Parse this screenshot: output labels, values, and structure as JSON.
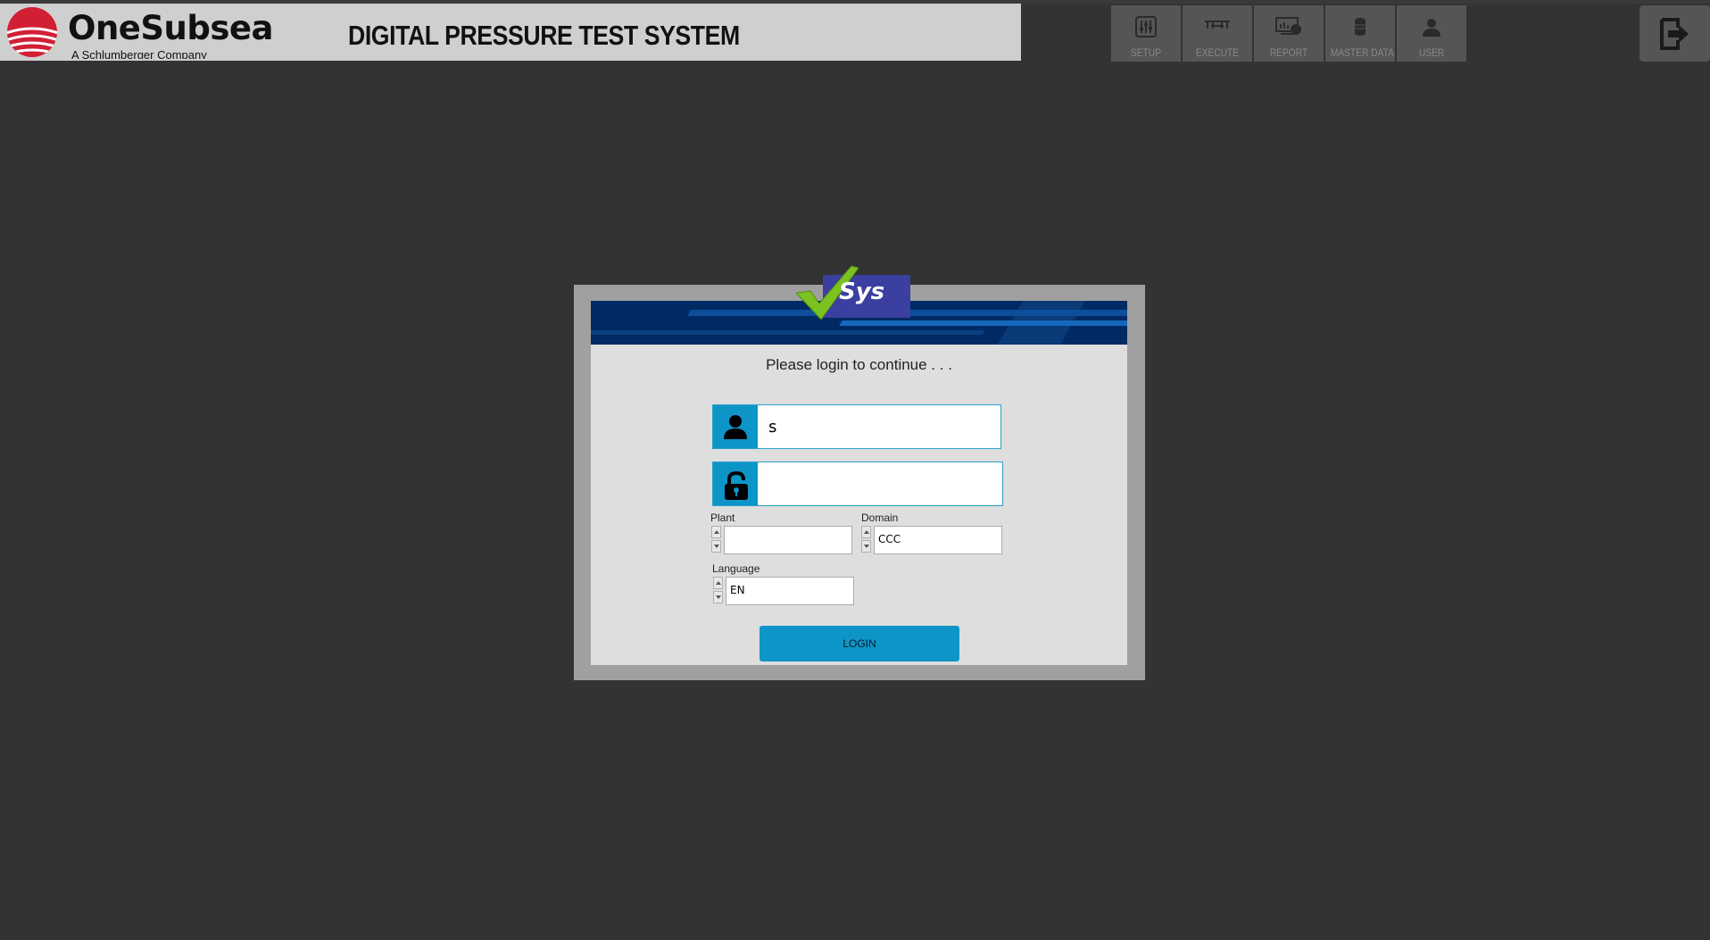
{
  "header": {
    "brand": "OneSubsea",
    "brand_sub": "A Schlumberger Company",
    "app_title": "DIGITAL PRESSURE TEST SYSTEM"
  },
  "nav": {
    "items": [
      {
        "label": "SETUP",
        "icon": "sliders-icon"
      },
      {
        "label": "EXECUTE",
        "icon": "execute-icon"
      },
      {
        "label": "REPORT",
        "icon": "report-icon"
      },
      {
        "label": "MASTER DATA",
        "icon": "database-icon"
      },
      {
        "label": "USER",
        "icon": "user-icon"
      }
    ],
    "exit_icon": "exit-icon"
  },
  "login": {
    "logo_text": "Sys",
    "logo_tm": "™",
    "prompt": "Please login to continue . . .",
    "username": {
      "value": "s",
      "icon": "user-icon"
    },
    "password": {
      "value": "",
      "icon": "unlock-icon"
    },
    "plant": {
      "label": "Plant",
      "value": ""
    },
    "domain": {
      "label": "Domain",
      "value": "CCC"
    },
    "language": {
      "label": "Language",
      "value": "EN"
    },
    "login_button": "LOGIN"
  },
  "colors": {
    "background": "#333333",
    "accent": "#0e95c8",
    "banner": "#002a63",
    "header_panel": "#cfcfcf"
  }
}
